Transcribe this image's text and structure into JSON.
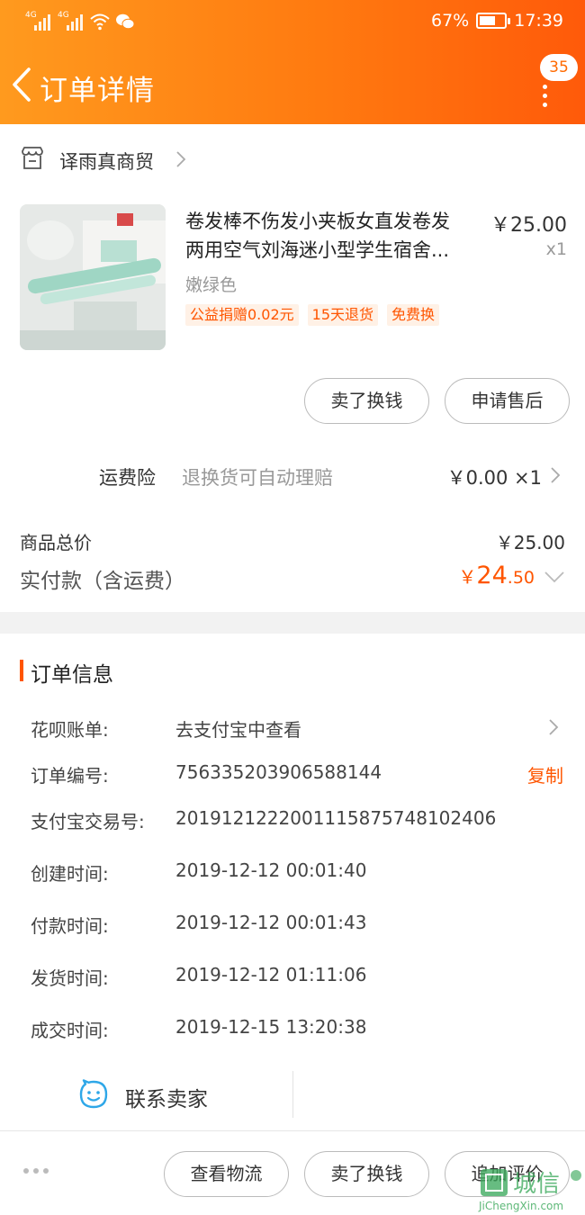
{
  "status_bar": {
    "network1": "4G",
    "network2": "4G",
    "battery": "67%",
    "battery_level": 0.67,
    "time": "17:39"
  },
  "header": {
    "title": "订单详情",
    "message_count": "35"
  },
  "shop": {
    "name": "译雨真商贸"
  },
  "item": {
    "title_line1": "卷发棒不伤发小夹板女直发卷发",
    "title_line2": "两用空气刘海迷小型学生宿舍...",
    "price": "￥25.00",
    "quantity": "x1",
    "sku": "嫩绿色",
    "tags": [
      "公益捐赠0.02元",
      "15天退货",
      "免费换"
    ],
    "actions": [
      "卖了换钱",
      "申请售后"
    ]
  },
  "insurance": {
    "label": "运费险",
    "description": "退换货可自动理赔",
    "price": "￥0.00 ×1"
  },
  "summary": {
    "total_label": "商品总价",
    "total_value": "￥25.00",
    "paid_label": "实付款（含运费）",
    "paid_currency": "￥",
    "paid_integer": "24",
    "paid_decimal": ".50"
  },
  "order_info": {
    "title": "订单信息",
    "rows": [
      {
        "key": "花呗账单:",
        "value": "去支付宝中查看"
      },
      {
        "key": "订单编号:",
        "value": "756335203906588144"
      },
      {
        "key": "支付宝交易号:",
        "value": "2019121222001115875748102406"
      },
      {
        "key": "创建时间:",
        "value": "2019-12-12 00:01:40"
      },
      {
        "key": "付款时间:",
        "value": "2019-12-12 00:01:43"
      },
      {
        "key": "发货时间:",
        "value": "2019-12-12 01:11:06"
      },
      {
        "key": "成交时间:",
        "value": "2019-12-15 13:20:38"
      }
    ],
    "copy_label": "复制"
  },
  "contact": {
    "label": "联系卖家"
  },
  "bottom_bar": {
    "actions": [
      "查看物流",
      "卖了换钱",
      "追加评价"
    ]
  },
  "watermark": {
    "text_cn": "城信",
    "text_en": "JiChengXin.com"
  },
  "colors": {
    "header_start": "#ff9a1e",
    "header_end": "#ff5a0a",
    "accent": "#ff5500",
    "tag_bg": "#fff1e6"
  }
}
